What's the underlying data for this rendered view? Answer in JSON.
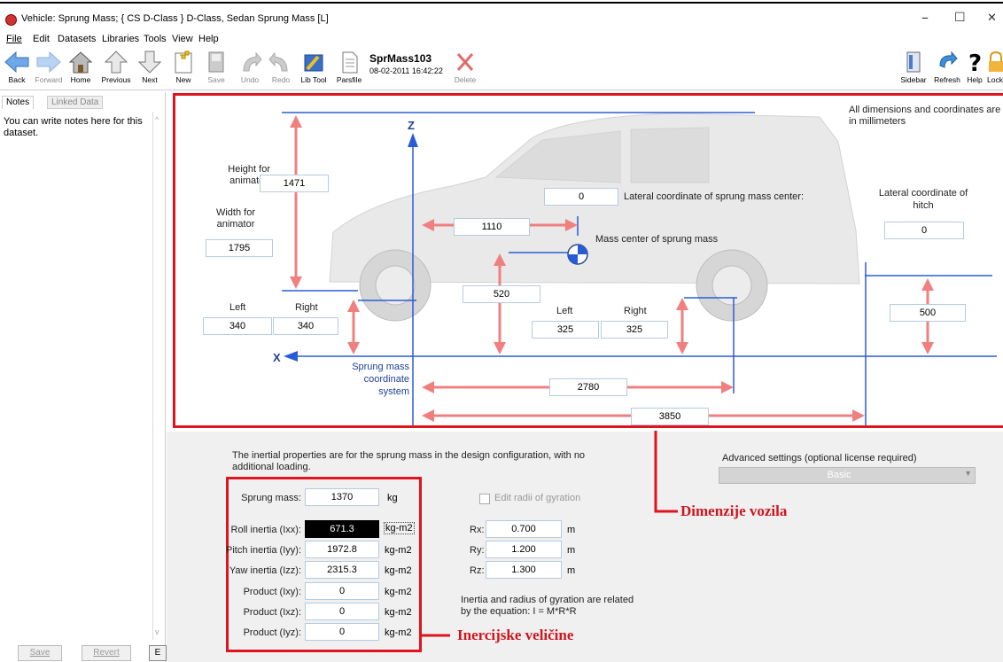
{
  "window": {
    "title": "Vehicle: Sprung Mass;  { CS D-Class }  D-Class, Sedan Sprung Mass [L]",
    "minimize": "–",
    "maximize": "☐",
    "close": "✕"
  },
  "menu": [
    "File",
    "Edit",
    "Datasets",
    "Libraries",
    "Tools",
    "View",
    "Help"
  ],
  "toolbar": {
    "back": "Back",
    "forward": "Forward",
    "home": "Home",
    "previous": "Previous",
    "next": "Next",
    "new": "New",
    "save": "Save",
    "undo": "Undo",
    "redo": "Redo",
    "libtool": "Lib Tool",
    "parsfile": "Parsfile",
    "dataset_name": "SprMass103",
    "dataset_date": "08-02-2011 16:42:22",
    "delete": "Delete",
    "sidebar": "Sidebar",
    "refresh": "Refresh",
    "help": "Help",
    "lock": "Lock"
  },
  "sidebar": {
    "tabs": [
      "Notes",
      "Linked Data"
    ],
    "notes": "You can write notes here for this dataset.",
    "buttons": {
      "save": "Save",
      "revert": "Revert",
      "e": "E"
    }
  },
  "diagram": {
    "note": "All dimensions and coordinates are in millimeters",
    "height_label": "Height for animator:",
    "height": "1471",
    "width_label": "Width for animator",
    "width": "1795",
    "lateral_label": "Lateral coordinate of sprung mass center:",
    "lateral": "0",
    "hitch_label": "Lateral coordinate of hitch",
    "hitch": "0",
    "x_cg": "1110",
    "cg_label": "Mass center of sprung mass",
    "z_cg": "520",
    "front_left_label": "Left",
    "front_right_label": "Right",
    "front_left": "340",
    "front_right": "340",
    "rear_left_label": "Left",
    "rear_right_label": "Right",
    "rear_left": "325",
    "rear_right": "325",
    "hitch_height": "500",
    "wheelbase": "2780",
    "hitch_x": "3850",
    "cs_label": "Sprung mass coordinate system",
    "axis_z": "Z",
    "axis_x": "X"
  },
  "inertia": {
    "intro": "The inertial properties are for the sprung mass in the design configuration, with no additional loading.",
    "mass_label": "Sprung mass:",
    "mass": "1370",
    "mass_unit": "kg",
    "rows": [
      {
        "label": "Roll inertia (Ixx):",
        "value": "671.3",
        "unit": "kg-m2"
      },
      {
        "label": "Pitch inertia (Iyy):",
        "value": "1972.8",
        "unit": "kg-m2"
      },
      {
        "label": "Yaw inertia (Izz):",
        "value": "2315.3",
        "unit": "kg-m2"
      },
      {
        "label": "Product (Ixy):",
        "value": "0",
        "unit": "kg-m2"
      },
      {
        "label": "Product (Ixz):",
        "value": "0",
        "unit": "kg-m2"
      },
      {
        "label": "Product (Iyz):",
        "value": "0",
        "unit": "kg-m2"
      }
    ],
    "radii_label": "Edit radii of gyration",
    "radii": [
      {
        "label": "Rx:",
        "value": "0.700",
        "unit": "m"
      },
      {
        "label": "Ry:",
        "value": "1.200",
        "unit": "m"
      },
      {
        "label": "Rz:",
        "value": "1.300",
        "unit": "m"
      }
    ],
    "equation": "Inertia and radius of gyration are related by the equation: I = M*R*R",
    "advanced_label": "Advanced settings (optional license required)",
    "advanced_value": "Basic"
  },
  "annotations": {
    "dimensions": "Dimenzije vozila",
    "inertia": "Inercijske veličine"
  },
  "colors": {
    "red": "#e0141e",
    "arrow": "#f08080",
    "blue": "#2a5bd7",
    "field_border": "#b6cbe0"
  }
}
